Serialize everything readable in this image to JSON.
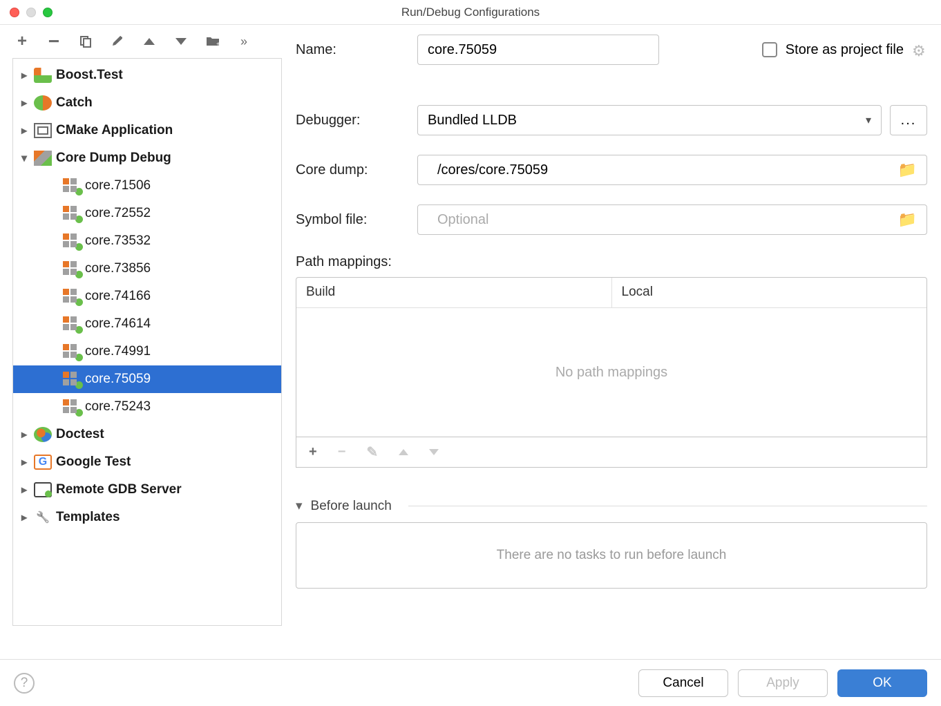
{
  "window": {
    "title": "Run/Debug Configurations"
  },
  "toolbar": [
    "add",
    "remove",
    "copy",
    "wrench",
    "up",
    "down",
    "folder",
    "more"
  ],
  "tree": {
    "groups": [
      {
        "label": "Boost.Test",
        "icon": "ic-boost",
        "expanded": false,
        "children": []
      },
      {
        "label": "Catch",
        "icon": "ic-catch",
        "expanded": false,
        "children": []
      },
      {
        "label": "CMake Application",
        "icon": "ic-cmake",
        "expanded": false,
        "children": []
      },
      {
        "label": "Core Dump Debug",
        "icon": "ic-dump",
        "expanded": true,
        "children": [
          {
            "label": "core.71506"
          },
          {
            "label": "core.72552"
          },
          {
            "label": "core.73532"
          },
          {
            "label": "core.73856"
          },
          {
            "label": "core.74166"
          },
          {
            "label": "core.74614"
          },
          {
            "label": "core.74991"
          },
          {
            "label": "core.75059",
            "selected": true
          },
          {
            "label": "core.75243"
          }
        ]
      },
      {
        "label": "Doctest",
        "icon": "ic-doctest",
        "expanded": false,
        "children": []
      },
      {
        "label": "Google Test",
        "icon": "ic-gtest",
        "expanded": false,
        "children": []
      },
      {
        "label": "Remote GDB Server",
        "icon": "ic-gdb",
        "expanded": false,
        "children": []
      },
      {
        "label": "Templates",
        "icon": "ic-wrench",
        "expanded": false,
        "children": []
      }
    ]
  },
  "form": {
    "name_label": "Name:",
    "name_value": "core.75059",
    "store_as_project": "Store as project file",
    "debugger_label": "Debugger:",
    "debugger_value": "Bundled LLDB",
    "coredump_label": "Core dump:",
    "coredump_value": "/cores/core.75059",
    "symbolfile_label": "Symbol file:",
    "symbolfile_placeholder": "Optional",
    "symbolfile_value": "",
    "path_mappings_label": "Path mappings:",
    "path_headers": {
      "build": "Build",
      "local": "Local"
    },
    "path_empty": "No path mappings",
    "before_launch_label": "Before launch",
    "before_launch_empty": "There are no tasks to run before launch"
  },
  "footer": {
    "cancel": "Cancel",
    "apply": "Apply",
    "ok": "OK"
  }
}
